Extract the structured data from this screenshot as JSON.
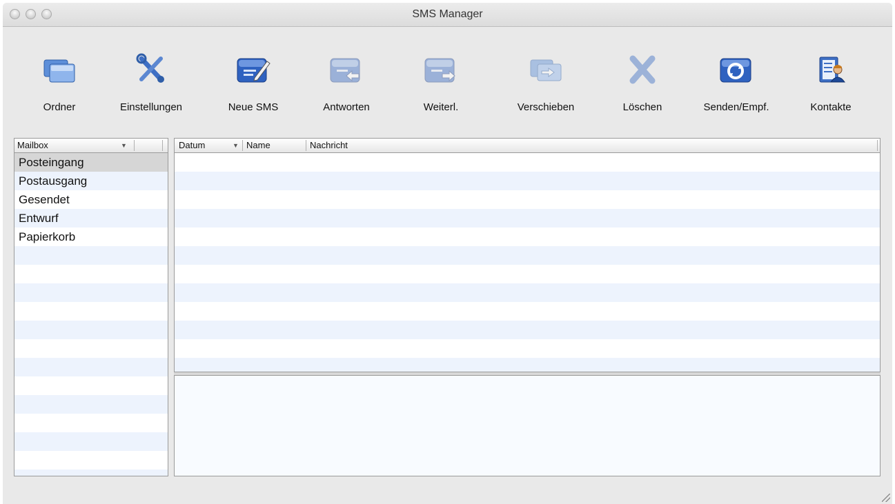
{
  "window": {
    "title": "SMS Manager"
  },
  "toolbar": {
    "items": [
      {
        "label": "Ordner",
        "icon": "folders-icon",
        "enabled": true
      },
      {
        "label": "Einstellungen",
        "icon": "tools-icon",
        "enabled": true
      },
      {
        "label": "Neue SMS",
        "icon": "new-message-icon",
        "enabled": true
      },
      {
        "label": "Antworten",
        "icon": "reply-icon",
        "enabled": false
      },
      {
        "label": "Weiterl.",
        "icon": "forward-icon",
        "enabled": false
      },
      {
        "label": "Verschieben",
        "icon": "move-icon",
        "enabled": false
      },
      {
        "label": "Löschen",
        "icon": "delete-icon",
        "enabled": false
      },
      {
        "label": "Senden/Empf.",
        "icon": "send-receive-icon",
        "enabled": true
      },
      {
        "label": "Kontakte",
        "icon": "contacts-icon",
        "enabled": true
      }
    ]
  },
  "sidebar": {
    "header": "Mailbox",
    "items": [
      {
        "label": "Posteingang",
        "selected": true
      },
      {
        "label": "Postausgang",
        "selected": false
      },
      {
        "label": "Gesendet",
        "selected": false
      },
      {
        "label": "Entwurf",
        "selected": false
      },
      {
        "label": "Papierkorb",
        "selected": false
      }
    ]
  },
  "message_list": {
    "columns": [
      "Datum",
      "Name",
      "Nachricht"
    ],
    "rows": []
  },
  "colors": {
    "stripe": "#edf3fd",
    "selection": "#d6d6d6",
    "icon_blue": "#3e6fc4"
  }
}
